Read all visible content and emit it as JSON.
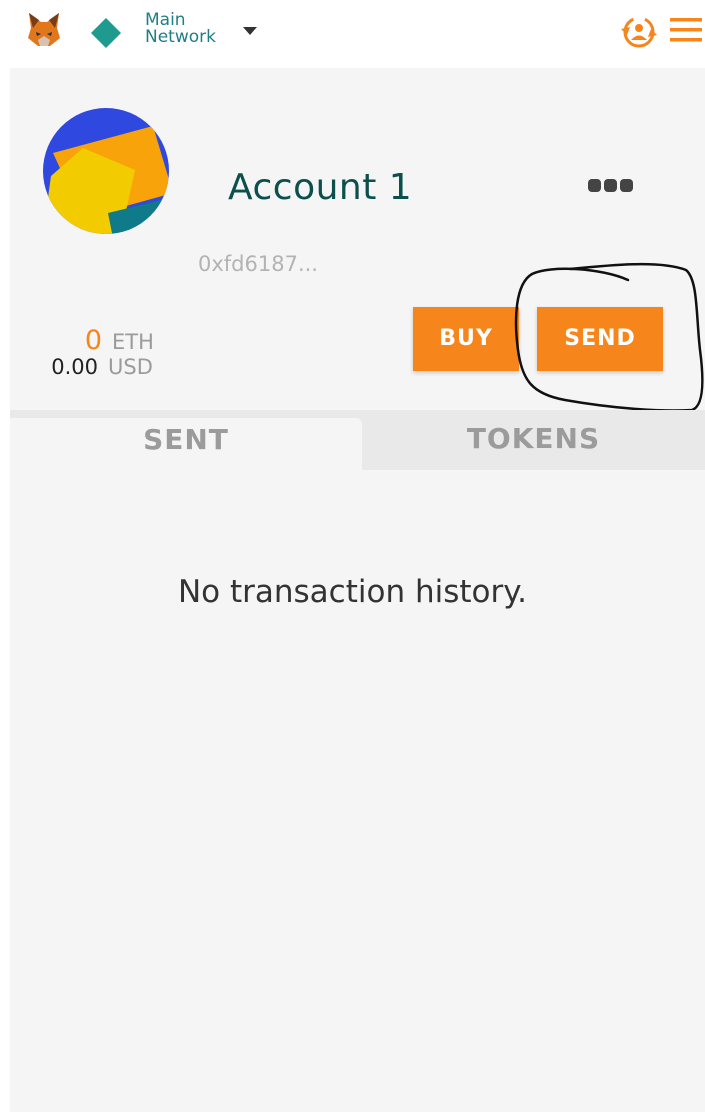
{
  "header": {
    "network_line1": "Main",
    "network_line2": "Network"
  },
  "account": {
    "name": "Account 1",
    "address": "0xfd6187..."
  },
  "balance": {
    "eth_value": "0",
    "eth_unit": "ETH",
    "usd_value": "0.00",
    "usd_unit": "USD"
  },
  "actions": {
    "buy_label": "BUY",
    "send_label": "SEND"
  },
  "tabs": [
    {
      "label": "SENT",
      "active": true
    },
    {
      "label": "TOKENS",
      "active": false
    }
  ],
  "empty_state": "No transaction history.",
  "colors": {
    "accent": "#f6851b",
    "network": "#1f9a8f",
    "account_name": "#0d4f4c",
    "panel_bg": "#f5f5f5"
  },
  "icons": {
    "logo": "metamask-fox-icon",
    "network": "network-diamond-icon",
    "network_menu": "caret-down-icon",
    "account_switch": "account-switch-icon",
    "menu": "hamburger-menu-icon",
    "more": "more-dots-icon"
  }
}
